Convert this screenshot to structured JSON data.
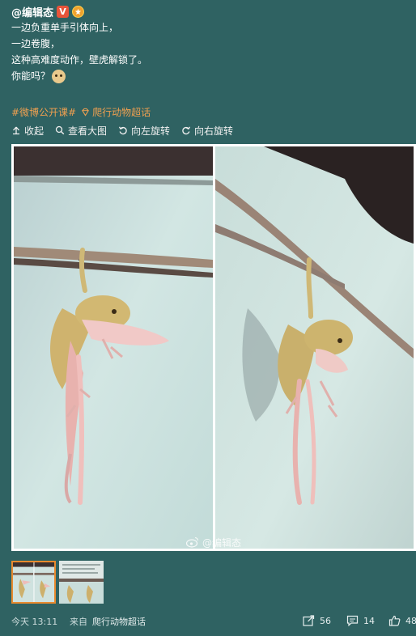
{
  "post": {
    "author": "@编辑态",
    "verified_badge": "V",
    "lines": [
      "一边负重单手引体向上，",
      "一边卷腹，",
      "这种高难度动作，壁虎解锁了。",
      "你能吗？"
    ],
    "topic": "#微博公开课#",
    "supertopic": "爬行动物超话",
    "icons": {
      "verified": "verified-icon",
      "medal": "medal-icon",
      "emoji": "doge-emoji-icon",
      "supertopic": "supertopic-icon"
    }
  },
  "toolbar": {
    "collapse_label": "收起",
    "view_large_label": "查看大图",
    "rotate_left_label": "向左旋转",
    "rotate_right_label": "向右旋转"
  },
  "image": {
    "watermark": "@编辑态"
  },
  "footer": {
    "time": "今天 13:11",
    "source_label": "来自",
    "source": "爬行动物超话",
    "reposts": "56",
    "comments": "14",
    "likes": "48"
  },
  "colors": {
    "background": "#2f6262",
    "topic": "#f0a050",
    "thumb_active_border": "#e88a2e",
    "wall": "#c9e0de"
  }
}
